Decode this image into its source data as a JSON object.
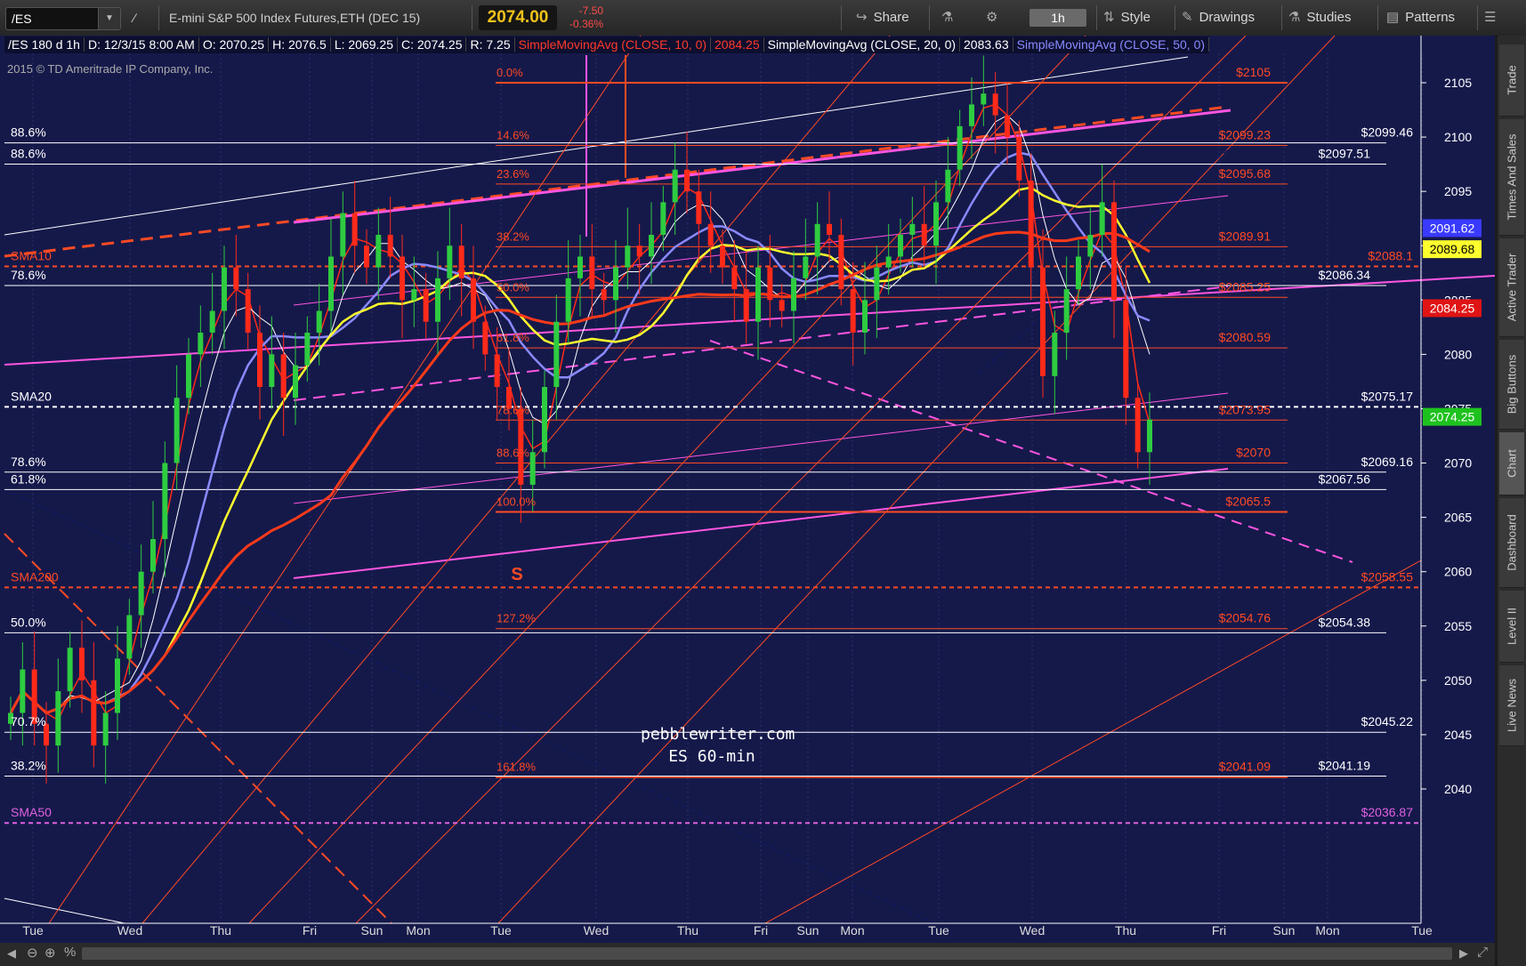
{
  "toolbar": {
    "symbol": "/ES",
    "description": "E-mini S&P 500 Index Futures,ETH (DEC 15)",
    "last": "2074.00",
    "change": "-7.50",
    "change_pct": "-0.36%",
    "share": "Share",
    "timeframe": "1h",
    "style": "Style",
    "drawings": "Drawings",
    "studies": "Studies",
    "patterns": "Patterns"
  },
  "legend": {
    "header": "/ES 180 d 1h",
    "date": "D: 12/3/15 8:00 AM",
    "open": "O: 2070.25",
    "high": "H: 2076.5",
    "low": "L: 2069.25",
    "close": "C: 2074.25",
    "range": "R: 7.25",
    "sma10": "SimpleMovingAvg (CLOSE, 10, 0)",
    "sma10_val": "2084.25",
    "sma20": "SimpleMovingAvg (CLOSE, 20, 0)",
    "sma20_val": "2083.63",
    "sma50": "SimpleMovingAvg (CLOSE, 50, 0)"
  },
  "copyright": "2015 © TD Ameritrade IP Company, Inc.",
  "watermark": [
    "pebblewriter.com",
    "ES 60-min"
  ],
  "sidebar_tabs": [
    "Trade",
    "Times And Sales",
    "Active Trader",
    "Big Buttons",
    "Chart",
    "Dashboard",
    "Level II",
    "Live News"
  ],
  "colors": {
    "background": "#15194a",
    "fib": "#ff4a24",
    "sma10": "#ff2a1a",
    "sma20": "#ffffff",
    "sma50": "#8a8aff",
    "sma_yellow": "#ffff2e",
    "sma_red_long": "#ff3a1a",
    "channel": "#ff55e0",
    "candle_up": "#2ecc40",
    "candle_down": "#ff2a1a"
  },
  "chart_data": {
    "type": "candlestick",
    "symbol": "/ES",
    "interval": "1h",
    "ylim": [
      2036,
      2110
    ],
    "y_ticks": [
      2040,
      2045,
      2050,
      2055,
      2060,
      2065,
      2070,
      2075,
      2080,
      2085,
      2090,
      2095,
      2100,
      2105
    ],
    "x_ticks": [
      "Tue",
      "Wed",
      "Thu",
      "Fri",
      "Sun",
      "Mon",
      "Tue",
      "Wed",
      "Thu",
      "Fri",
      "Sun",
      "Mon",
      "Tue",
      "Wed",
      "Thu",
      "Fri",
      "Sun",
      "Mon",
      "Tue"
    ],
    "price_badges": [
      {
        "label": "2091.62",
        "value": 2091.62,
        "color": "#3a3aff",
        "text": "#ffffff"
      },
      {
        "label": "2089.68",
        "value": 2089.68,
        "color": "#ffff2e",
        "text": "#000000"
      },
      {
        "label": "2084.25",
        "value": 2084.25,
        "color": "#e01414",
        "text": "#ffffff"
      },
      {
        "label": "2074.25",
        "value": 2074.25,
        "color": "#1ec21e",
        "text": "#ffffff"
      }
    ],
    "fib_levels": [
      {
        "pct": "0.0%",
        "price": "$2105",
        "value": 2105
      },
      {
        "pct": "14.6%",
        "price": "$2099.23",
        "value": 2099.23
      },
      {
        "pct": "23.6%",
        "price": "$2095.68",
        "value": 2095.68
      },
      {
        "pct": "38.2%",
        "price": "$2089.91",
        "value": 2089.91
      },
      {
        "pct": "50.0%",
        "price": "$2085.25",
        "value": 2085.25
      },
      {
        "pct": "61.8%",
        "price": "$2080.59",
        "value": 2080.59
      },
      {
        "pct": "78.6%",
        "price": "$2073.95",
        "value": 2073.95
      },
      {
        "pct": "88.6%",
        "price": "$2070",
        "value": 2070
      },
      {
        "pct": "100.0%",
        "price": "$2065.5",
        "value": 2065.5
      },
      {
        "pct": "127.2%",
        "price": "$2054.76",
        "value": 2054.76
      },
      {
        "pct": "161.8%",
        "price": "$2041.09",
        "value": 2041.09
      }
    ],
    "white_levels": [
      {
        "left": "88.6%",
        "right": "$2099.46",
        "value": 2099.46
      },
      {
        "left": "88.6%",
        "right": "$2097.51",
        "value": 2097.51
      },
      {
        "left": "78.6%",
        "right": "$2086.34",
        "value": 2086.34
      },
      {
        "left": "SMA20",
        "right": "$2075.17",
        "value": 2075.17,
        "dashed": true
      },
      {
        "left": "78.6%",
        "right": "$2069.16",
        "value": 2069.16
      },
      {
        "left": "61.8%",
        "right": "$2067.56",
        "value": 2067.56
      },
      {
        "left": "50.0%",
        "right": "$2054.38",
        "value": 2054.38
      },
      {
        "left": "70.7%",
        "right": "$2045.22",
        "value": 2045.22
      },
      {
        "left": "38.2%",
        "right": "$2041.19",
        "value": 2041.19
      }
    ],
    "sma_levels": [
      {
        "left": "SMA10",
        "right": "$2088.1",
        "value": 2088.1,
        "color": "#ff4a24"
      },
      {
        "left": "SMA200",
        "right": "$2058.55",
        "value": 2058.55,
        "color": "#ff4a24"
      },
      {
        "left": "SMA50",
        "right": "$2036.87",
        "value": 2036.87,
        "color": "#e060e0"
      }
    ],
    "annotation": "S",
    "closes": [
      2047,
      2051,
      2046,
      2044,
      2049,
      2053,
      2050,
      2044,
      2047,
      2052,
      2056,
      2060,
      2063,
      2070,
      2076,
      2080,
      2082,
      2084,
      2088,
      2086,
      2082,
      2077,
      2080,
      2076,
      2079,
      2082,
      2084,
      2089,
      2093,
      2090,
      2088,
      2091,
      2089,
      2085,
      2086,
      2083,
      2087,
      2090,
      2087,
      2083,
      2080,
      2077,
      2075,
      2068,
      2071,
      2077,
      2083,
      2087,
      2089,
      2086,
      2085,
      2088,
      2090,
      2089,
      2091,
      2094,
      2097,
      2095,
      2092,
      2090,
      2088,
      2086,
      2083,
      2088,
      2085,
      2084,
      2087,
      2089,
      2092,
      2091,
      2086,
      2082,
      2085,
      2088,
      2089,
      2091,
      2092,
      2090,
      2094,
      2097,
      2101,
      2103,
      2104,
      2102,
      2100,
      2096,
      2088,
      2078,
      2082,
      2086,
      2089,
      2091,
      2094,
      2085,
      2076,
      2071,
      2074
    ]
  }
}
